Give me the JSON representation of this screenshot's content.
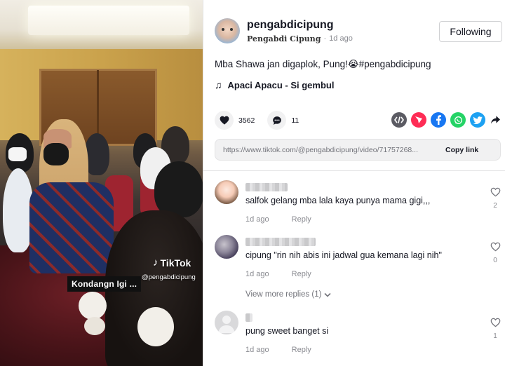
{
  "video": {
    "watermark": "TikTok",
    "handle": "@pengabdicipung",
    "caption": "Kondangn Igi ..."
  },
  "author": {
    "username": "pengabdicipung",
    "nickname": "Pengabdi Cipung",
    "separator": "·",
    "age": "1d ago",
    "follow_label": "Following"
  },
  "post": {
    "description": "Mba Shawa jan digaplok, Pung!😭#pengabdicipung",
    "music": "Apaci Apacu - Si gembul"
  },
  "stats": {
    "likes": "3562",
    "comments": "11"
  },
  "share": {
    "icons": [
      "embed-icon",
      "send-icon",
      "facebook-icon",
      "whatsapp-icon",
      "twitter-icon",
      "share-arrow-icon"
    ],
    "colors": {
      "embed": "#5b5b63",
      "send": "#fe2c55",
      "facebook": "#1877f2",
      "whatsapp": "#25d366",
      "twitter": "#1da1f2"
    }
  },
  "link": {
    "url": "https://www.tiktok.com/@pengabdicipung/video/71757268...",
    "copy_label": "Copy link"
  },
  "comments": [
    {
      "text": "salfok gelang mba lala kaya punya mama gigi,,,",
      "age": "1d ago",
      "reply_label": "Reply",
      "likes": "2"
    },
    {
      "text": "cipung \"rin nih abis ini jadwal gua kemana lagi nih\"",
      "age": "1d ago",
      "reply_label": "Reply",
      "likes": "0"
    },
    {
      "text": "pung sweet banget si",
      "age": "1d ago",
      "reply_label": "Reply",
      "likes": "1"
    }
  ],
  "view_more": {
    "label": "View more replies (1)"
  }
}
